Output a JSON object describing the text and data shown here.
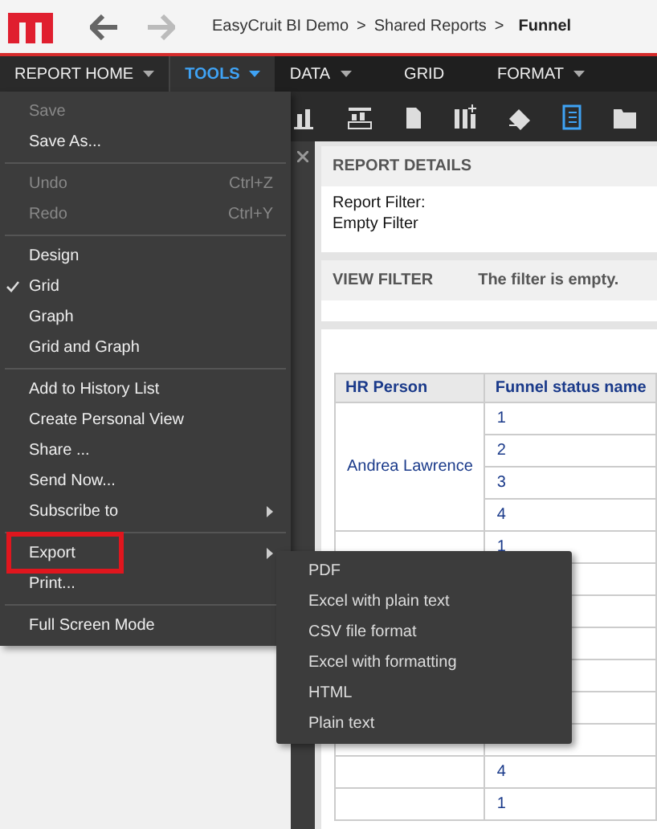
{
  "header": {
    "breadcrumbs": [
      {
        "label": "EasyCruit BI Demo",
        "kind": "link"
      },
      {
        "label": ">",
        "kind": "separator"
      },
      {
        "label": "Shared Reports",
        "kind": "link"
      },
      {
        "label": ">",
        "kind": "separator"
      },
      {
        "label": "Funnel",
        "kind": "current"
      }
    ]
  },
  "nav_tabs": [
    {
      "label": "REPORT HOME",
      "selected": false,
      "dropdown": true
    },
    {
      "label": "TOOLS",
      "selected": true,
      "dropdown": true
    },
    {
      "label": "DATA",
      "selected": false,
      "dropdown": true
    },
    {
      "label": "GRID",
      "selected": false,
      "dropdown": false
    },
    {
      "label": "FORMAT",
      "selected": false,
      "dropdown": true
    }
  ],
  "menu": {
    "groups": [
      [
        {
          "label": "Save",
          "disabled": true
        },
        {
          "label": "Save As...",
          "disabled": false
        }
      ],
      [
        {
          "label": "Undo",
          "disabled": true,
          "shortcut": "Ctrl+Z"
        },
        {
          "label": "Redo",
          "disabled": true,
          "shortcut": "Ctrl+Y"
        }
      ],
      [
        {
          "label": "Design",
          "disabled": false,
          "checked": false
        },
        {
          "label": "Grid",
          "disabled": false,
          "checked": true
        },
        {
          "label": "Graph",
          "disabled": false,
          "checked": false
        },
        {
          "label": "Grid and Graph",
          "disabled": false,
          "checked": false
        }
      ],
      [
        {
          "label": "Add to History List",
          "disabled": false
        },
        {
          "label": "Create Personal View",
          "disabled": false
        },
        {
          "label": "Share ...",
          "disabled": false
        },
        {
          "label": "Send Now...",
          "disabled": false
        },
        {
          "label": "Subscribe to",
          "disabled": false,
          "submenu": true
        }
      ],
      [
        {
          "label": "Export",
          "disabled": false,
          "submenu": true,
          "highlighted": true
        },
        {
          "label": "Print...",
          "disabled": false
        }
      ],
      [
        {
          "label": "Full Screen Mode",
          "disabled": false
        }
      ]
    ]
  },
  "submenu": {
    "items": [
      "PDF",
      "Excel with plain text",
      "CSV file format",
      "Excel with formatting",
      "HTML",
      "Plain text"
    ]
  },
  "report_details": {
    "title": "REPORT DETAILS",
    "lines": [
      "Report Filter:",
      "Empty Filter"
    ]
  },
  "view_filter": {
    "title": "VIEW FILTER",
    "text": "The filter is empty."
  },
  "table": {
    "columns": [
      "HR Person",
      "Funnel status name"
    ],
    "groups": [
      {
        "hr_person": "Andrea Lawrence",
        "statuses": [
          "1",
          "2",
          "3",
          "4"
        ]
      },
      {
        "statuses": [
          "1"
        ]
      },
      {
        "statuses": [
          "4"
        ]
      },
      {
        "statuses": [
          "1"
        ]
      }
    ]
  }
}
